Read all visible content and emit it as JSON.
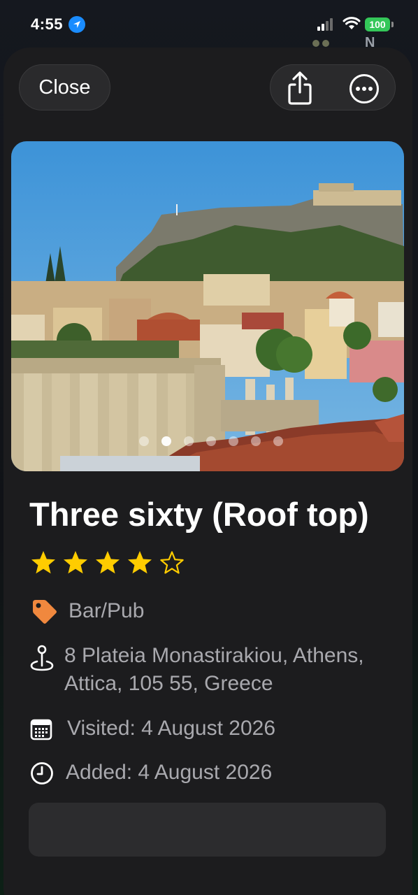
{
  "status_bar": {
    "time": "4:55",
    "battery": "100",
    "background_letter": "N"
  },
  "header": {
    "close_label": "Close",
    "share_icon": "share-icon",
    "more_icon": "more-options-icon"
  },
  "photo": {
    "description_icon": "photo",
    "page_count": 7,
    "active_page": 2
  },
  "place": {
    "title": "Three sixty (Roof top)",
    "rating": 4,
    "rating_max": 5,
    "category": "Bar/Pub",
    "address_line1": "8 Plateia Monastirakiou, Athens,",
    "address_line2": "Attica, 105 55, Greece",
    "visited": "Visited: 4 August 2026",
    "added": "Added: 4 August 2026"
  },
  "colors": {
    "accent_star": "#ffcc00",
    "tag_orange": "#f0883e",
    "sheet_bg": "#1c1c1e",
    "battery_green": "#34c759",
    "location_blue": "#1a8cff"
  }
}
